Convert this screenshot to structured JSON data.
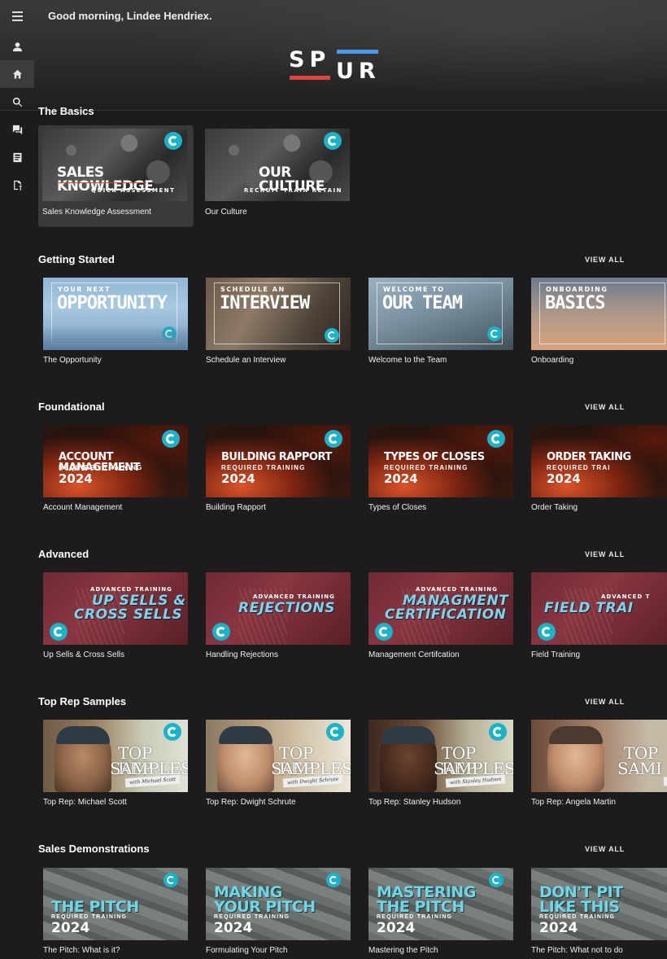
{
  "header": {
    "greeting": "Good morning, Lindee Hendriex.",
    "logo": {
      "top": "SP",
      "bottom": "UR",
      "accent_red": "#e0443a",
      "accent_blue": "#4a9ce8"
    }
  },
  "sidebar": {
    "items": [
      {
        "icon": "person-icon",
        "name": "Profile"
      },
      {
        "icon": "home-icon",
        "name": "Home",
        "active": true
      },
      {
        "icon": "search-icon",
        "name": "Search"
      },
      {
        "icon": "chat-icon",
        "name": "Messages"
      },
      {
        "icon": "library-icon",
        "name": "Library"
      },
      {
        "icon": "assignment-icon",
        "name": "Assignments"
      }
    ]
  },
  "view_all_label": "VIEW ALL",
  "sections": [
    {
      "title": "The Basics",
      "cards": [
        {
          "label": "Sales Knowledge Assessment",
          "big": "SALES KNOWLEDGE",
          "small": "QUICK ASSESSMENT"
        },
        {
          "label": "Our Culture",
          "big": "OUR CULTURE",
          "small": "RECRUIT TRAIN RETAIN"
        }
      ]
    },
    {
      "title": "Getting Started",
      "cards": [
        {
          "label": "The Opportunity",
          "small": "YOUR NEXT",
          "big": "OPPORTUNITY"
        },
        {
          "label": "Schedule an Interview",
          "small": "SCHEDULE AN",
          "big": "INTERVIEW"
        },
        {
          "label": "Welcome to the Team",
          "small": "WELCOME TO",
          "big": "OUR TEAM"
        },
        {
          "label": "Onboarding",
          "small": "ONBOARDING",
          "big": "BASICS"
        }
      ]
    },
    {
      "title": "Foundational",
      "cards": [
        {
          "label": "Account Management",
          "big": "ACCOUNT MANAGEMENT",
          "small": "REQUIRED TRAINING",
          "year": "2024"
        },
        {
          "label": "Building Rapport",
          "big": "BUILDING RAPPORT",
          "small": "REQUIRED TRAINING",
          "year": "2024"
        },
        {
          "label": "Types of Closes",
          "big": "TYPES OF CLOSES",
          "small": "REQUIRED TRAINING",
          "year": "2024"
        },
        {
          "label": "Order Taking",
          "big": "ORDER TAKING",
          "small": "REQUIRED TRAI",
          "year": "2024"
        }
      ]
    },
    {
      "title": "Advanced",
      "cards": [
        {
          "label": "Up Sells & Cross Sells",
          "small": "ADVANCED TRAINING",
          "line1": "UP SELLS &",
          "line2": "CROSS SELLS"
        },
        {
          "label": "Handling Rejections",
          "small": "ADVANCED TRAINING",
          "line1": "REJECTIONS",
          "line2": ""
        },
        {
          "label": "Management Certifcation",
          "small": "ADVANCED TRAINING",
          "line1": "MANAGMENT",
          "line2": "CERTIFICATION"
        },
        {
          "label": "Field Training",
          "small": "ADVANCED T",
          "line1": "FIELD TRAI",
          "line2": ""
        }
      ]
    },
    {
      "title": "Top Rep Samples",
      "cards": [
        {
          "label": "Top Rep: Michael Scott",
          "line1": "TOP REP",
          "line2": "SAMPLES",
          "sig": "with Michael Scott"
        },
        {
          "label": "Top Rep: Dwight Schrute",
          "line1": "TOP REP",
          "line2": "SAMPLES",
          "sig": "with Dwight Schrute"
        },
        {
          "label": "Top Rep: Stanley Hudson",
          "line1": "TOP REP",
          "line2": "SAMPLES",
          "sig": "with Stanley Hudson"
        },
        {
          "label": "Top Rep: Angela Martin",
          "line1": "TOP",
          "line2": "SAMI",
          "sig": "wi"
        }
      ]
    },
    {
      "title": "Sales Demonstrations",
      "cards": [
        {
          "label": "The Pitch: What is it?",
          "line1": "",
          "line2": "THE PITCH",
          "small": "REQUIRED TRAINING",
          "year": "2024"
        },
        {
          "label": "Formulating Your Pitch",
          "line1": "MAKING",
          "line2": "YOUR PITCH",
          "small": "REQUIRED TRAINING",
          "year": "2024"
        },
        {
          "label": "Mastering the Pitch",
          "line1": "MASTERING",
          "line2": "THE PITCH",
          "small": "REQUIRED TRAINING",
          "year": "2024"
        },
        {
          "label": "The Pitch: What not to do",
          "line1": "DON'T PIT",
          "line2": "LIKE THIS",
          "small": "REQUIRED TRAINING",
          "year": "2024"
        }
      ]
    }
  ]
}
